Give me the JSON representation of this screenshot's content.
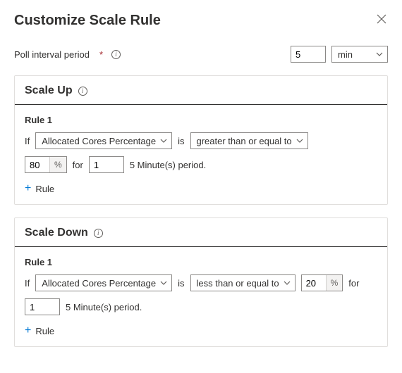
{
  "header": {
    "title": "Customize Scale Rule"
  },
  "poll": {
    "label": "Poll interval period",
    "required_marker": "*",
    "value": "5",
    "unit": "min"
  },
  "scale_up": {
    "title": "Scale Up",
    "rule_label": "Rule 1",
    "if_label": "If",
    "metric": "Allocated Cores Percentage",
    "is_label": "is",
    "operator": "greater than or equal to",
    "threshold": "80",
    "threshold_unit": "%",
    "for_label": "for",
    "period_count": "1",
    "period_text": "5 Minute(s) period.",
    "add_rule_label": "Rule"
  },
  "scale_down": {
    "title": "Scale Down",
    "rule_label": "Rule 1",
    "if_label": "If",
    "metric": "Allocated Cores Percentage",
    "is_label": "is",
    "operator": "less than or equal to",
    "threshold": "20",
    "threshold_unit": "%",
    "for_label": "for",
    "period_count": "1",
    "period_text": "5 Minute(s) period.",
    "add_rule_label": "Rule"
  }
}
